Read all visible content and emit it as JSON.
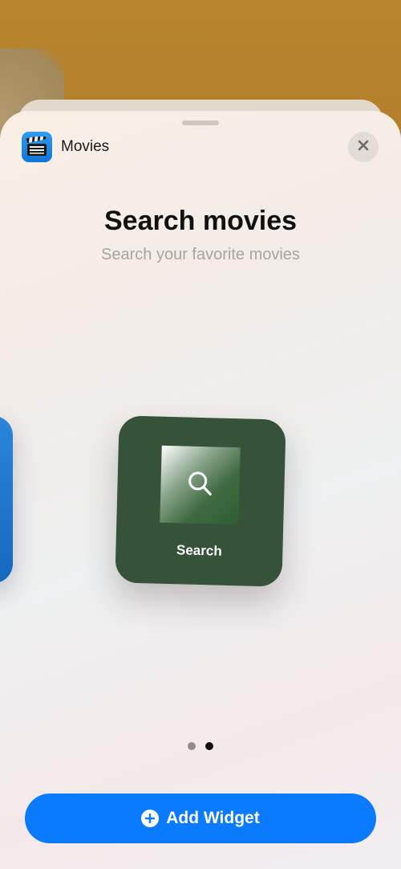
{
  "header": {
    "app_name": "Movies",
    "app_icon": "clapperboard-icon",
    "close_icon": "close-icon"
  },
  "title": "Search movies",
  "subtitle": "Search your favorite movies",
  "widget": {
    "label": "Search",
    "icon": "search-icon",
    "background_color": "#365239"
  },
  "pagination": {
    "total": 2,
    "active": 2
  },
  "actions": {
    "add_widget_label": "Add Widget",
    "add_widget_icon": "plus-circle-icon",
    "accent_color": "#0a7aff"
  }
}
